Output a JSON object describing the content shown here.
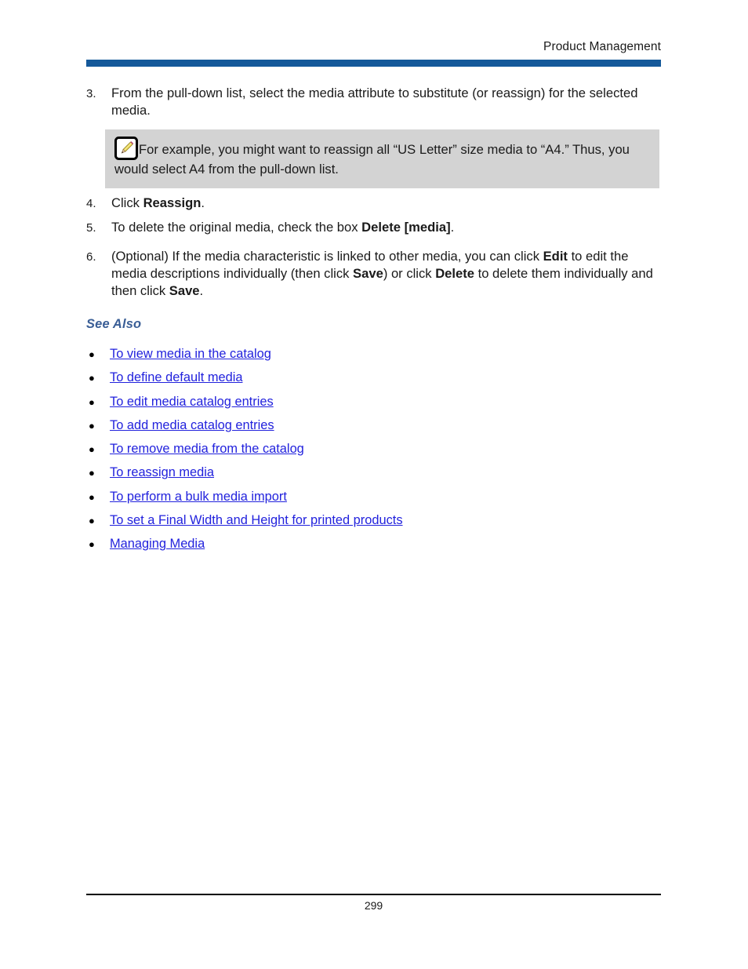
{
  "header": {
    "title": "Product Management",
    "accent_color": "#15599A"
  },
  "steps": [
    {
      "number": "3.",
      "segments": [
        {
          "text": "From the pull-down list, select the media attribute to substitute (or reassign) for the selected media.",
          "bold": false
        }
      ]
    },
    {
      "number": "4.",
      "segments": [
        {
          "text": "Click ",
          "bold": false
        },
        {
          "text": "Reassign",
          "bold": true
        },
        {
          "text": ".",
          "bold": false
        }
      ]
    },
    {
      "number": "5.",
      "segments": [
        {
          "text": "To delete the original media, check the box ",
          "bold": false
        },
        {
          "text": "Delete [media]",
          "bold": true
        },
        {
          "text": ".",
          "bold": false
        }
      ]
    },
    {
      "number": "6.",
      "segments": [
        {
          "text": "(Optional) If the media characteristic is linked to other media, you can click ",
          "bold": false
        },
        {
          "text": "Edit",
          "bold": true
        },
        {
          "text": " to edit the media descriptions individually (then click ",
          "bold": false
        },
        {
          "text": "Save",
          "bold": true
        },
        {
          "text": ") or click ",
          "bold": false
        },
        {
          "text": "Delete",
          "bold": true
        },
        {
          "text": " to delete them individually and then click ",
          "bold": false
        },
        {
          "text": "Save",
          "bold": true
        },
        {
          "text": ".",
          "bold": false
        }
      ]
    }
  ],
  "note": {
    "icon": "pencil-note-icon",
    "text": "For example, you might want to reassign all “US Letter” size media to “A4.” Thus, you would select A4 from the pull-down list.",
    "background_color": "#D3D3D3"
  },
  "see_also": {
    "heading": "See Also",
    "heading_color": "#3A5E96",
    "link_color": "#2222DD",
    "bullet_glyph": "●",
    "links": [
      "To view media in the catalog",
      "To define default media",
      "To edit media catalog entries",
      "To add media catalog entries",
      "To remove media from the catalog",
      "To reassign media",
      "To perform a bulk media import",
      "To set a Final Width and Height for printed products",
      "Managing Media"
    ]
  },
  "footer": {
    "page_number": "299"
  }
}
